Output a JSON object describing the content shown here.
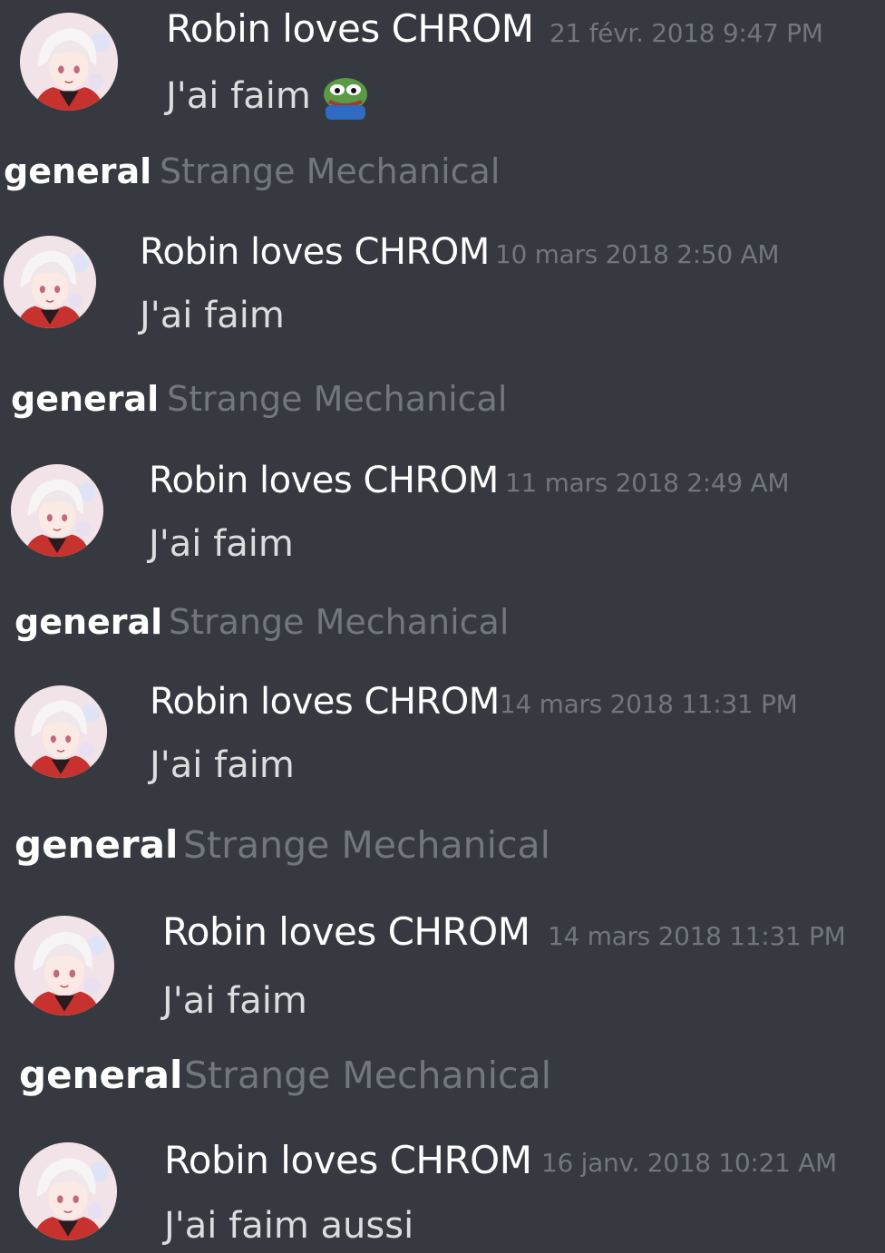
{
  "colors": {
    "background": "#36393f",
    "username": "#ffffff",
    "timestamp": "#72767d",
    "content": "#dcddde",
    "channel": "#ffffff",
    "server": "#72767d"
  },
  "messages": [
    {
      "username": "Robin loves CHROM",
      "timestamp": "21 févr. 2018 9:47 PM",
      "content": "J'ai faim",
      "emoji": "pepe-frog-emoji"
    },
    {
      "username": "Robin loves CHROM",
      "timestamp": "10 mars 2018 2:50 AM",
      "content": "J'ai faim"
    },
    {
      "username": "Robin loves CHROM",
      "timestamp": "11 mars 2018 2:49 AM",
      "content": "J'ai faim"
    },
    {
      "username": "Robin loves CHROM",
      "timestamp": "14 mars 2018 11:31 PM",
      "content": "J'ai faim"
    },
    {
      "username": "Robin loves CHROM",
      "timestamp": "14 mars 2018 11:31 PM",
      "content": "J'ai faim"
    },
    {
      "username": "Robin loves CHROM",
      "timestamp": "16 janv. 2018 10:21 AM",
      "content": "J'ai faim aussi"
    }
  ],
  "channels": [
    {
      "channel": "general",
      "server": "Strange Mechanical"
    },
    {
      "channel": "general",
      "server": "Strange Mechanical"
    },
    {
      "channel": "general",
      "server": "Strange Mechanical"
    },
    {
      "channel": "general",
      "server": "Strange Mechanical"
    },
    {
      "channel": "general",
      "server": "Strange Mechanical"
    }
  ]
}
